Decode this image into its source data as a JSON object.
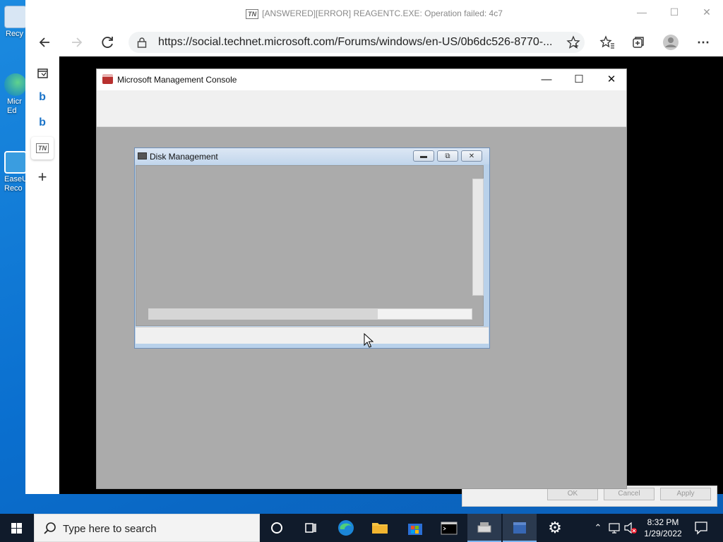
{
  "desktop": {
    "icons": [
      {
        "label": "Recy"
      },
      {
        "label": "Micr\nEd"
      },
      {
        "label": "EaseU\nReco"
      }
    ]
  },
  "browser": {
    "tab_title": "[ANSWERED][ERROR] REAGENTC.EXE: Operation failed: 4c7",
    "tab_badge": "TN",
    "url": "https://social.technet.microsoft.com/Forums/windows/en-US/0b6dc526-8770-...",
    "sidebar": [
      {
        "icon": "collections-icon"
      },
      {
        "icon": "bing-icon"
      },
      {
        "icon": "bing-icon"
      },
      {
        "icon": "technet-icon",
        "label": "TN"
      },
      {
        "icon": "add-icon"
      }
    ]
  },
  "mmc": {
    "title": "Microsoft Management Console"
  },
  "disk_management": {
    "title": "Disk Management",
    "hscroll_fraction": 0.71
  },
  "background_dialog": {
    "buttons": [
      "OK",
      "Cancel",
      "Apply"
    ]
  },
  "taskbar": {
    "search_placeholder": "Type here to search",
    "time": "8:32 PM",
    "date": "1/29/2022",
    "apps": [
      "cortana",
      "task-view",
      "edge",
      "file-explorer",
      "store",
      "command-prompt",
      "disk-management",
      "mmc",
      "settings"
    ]
  },
  "colors": {
    "desktop": "#0a78d4",
    "taskbar": "#101b2b",
    "mmc_body": "#ababab"
  }
}
